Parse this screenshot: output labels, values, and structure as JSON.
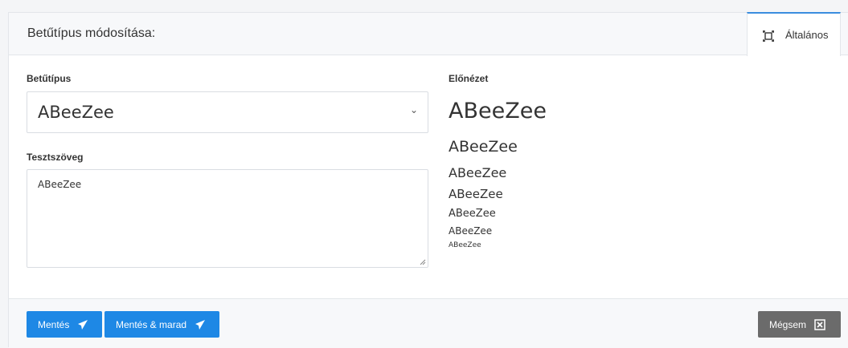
{
  "header": {
    "title": "Betűtípus módosítása:",
    "tab_label": "Általános"
  },
  "form": {
    "font_label": "Betűtípus",
    "font_selected": "ABeeZee",
    "test_text_label": "Tesztszöveg",
    "test_text_value": "ABeeZee"
  },
  "preview": {
    "label": "Előnézet",
    "samples": [
      "ABeeZee",
      "ABeeZee",
      "ABeeZee",
      "ABeeZee",
      "ABeeZee",
      "ABeeZee",
      "ABeeZee"
    ]
  },
  "footer": {
    "save_label": "Mentés",
    "save_stay_label": "Mentés & marad",
    "cancel_label": "Mégsem"
  },
  "colors": {
    "primary": "#1e88e5",
    "cancel": "#6b6b6b",
    "tab_accent": "#3a8dde"
  },
  "icons": {
    "tab": "expand-icon",
    "save": "paper-plane-icon",
    "cancel": "close-box-icon",
    "select": "chevron-down-icon"
  }
}
